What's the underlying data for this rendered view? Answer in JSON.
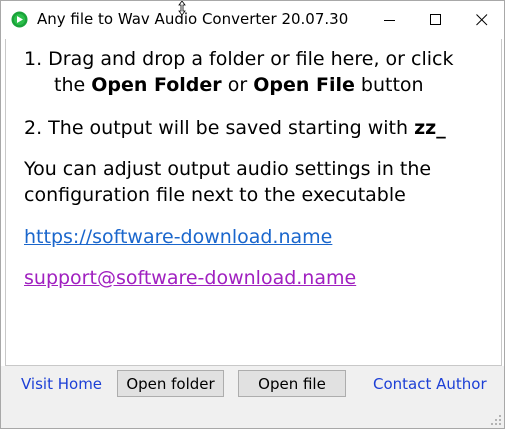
{
  "window": {
    "title": "Any file to Wav Audio Converter 20.07.30",
    "icons": {
      "app": "music-disc-icon",
      "minimize": "minimize-icon",
      "maximize": "maximize-icon",
      "close": "close-icon"
    }
  },
  "instructions": {
    "step1_prefix": "1. Drag and drop a folder or file here, or click",
    "step1_line2_the": "the",
    "step1_open_folder": "Open Folder",
    "step1_or": "or",
    "step1_open_file": "Open File",
    "step1_button": "button",
    "step2_prefix": "2. The output will be saved starting with",
    "step2_prefix_value": "zz_",
    "note_line1": "You can adjust output audio settings in the",
    "note_line2": "configuration file next to the executable",
    "website_link": "https://software-download.name",
    "email_link": "support@software-download.name"
  },
  "footer": {
    "visit_home": "Visit Home",
    "open_folder": "Open folder",
    "open_file": "Open file",
    "contact_author": "Contact Author"
  },
  "colors": {
    "link_blue": "#1a66cc",
    "link_purple": "#a020c0",
    "footer_link": "#1c3fd6",
    "footer_bg": "#f0f0f0",
    "app_icon_green": "#1aa33a"
  }
}
